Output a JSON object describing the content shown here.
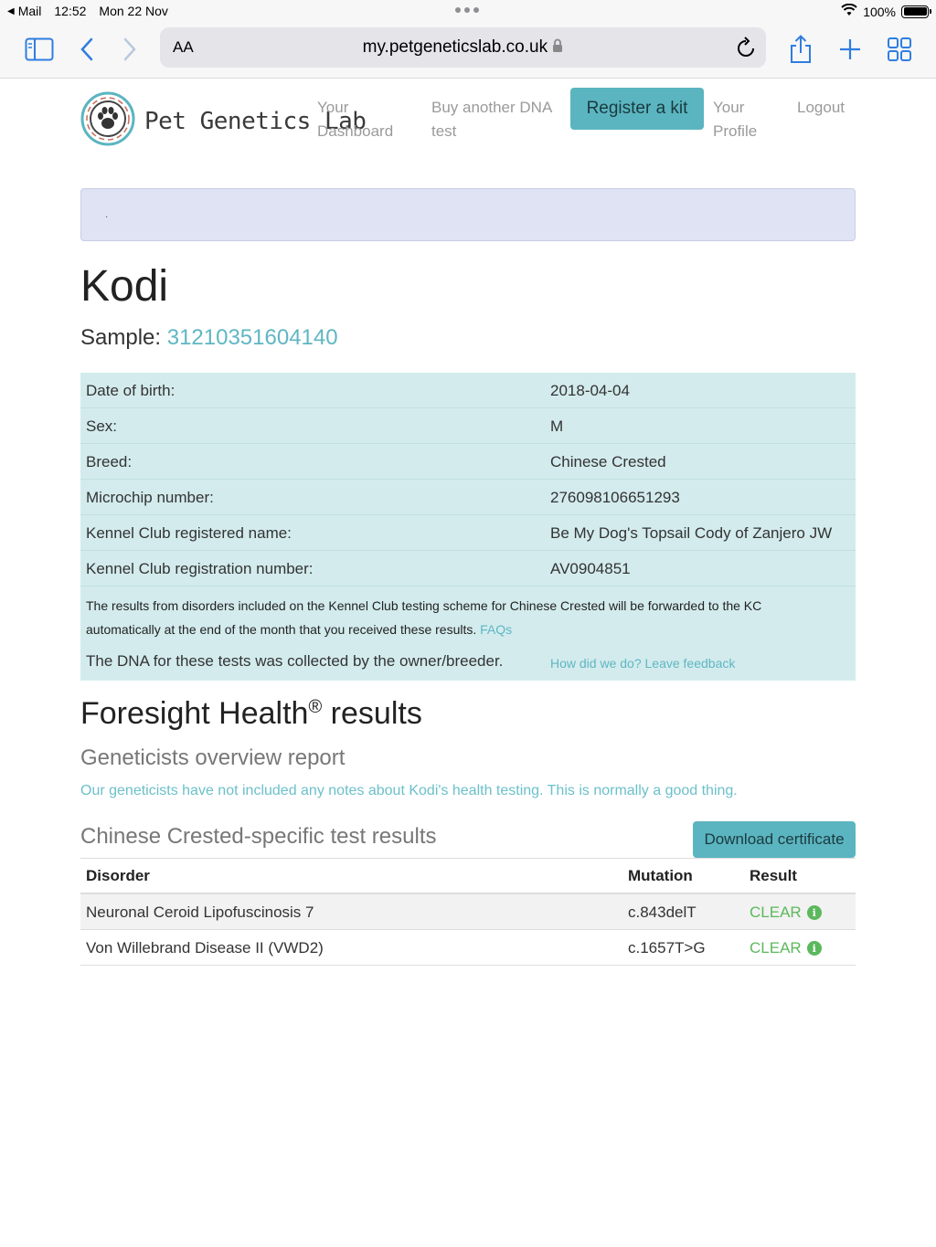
{
  "status_bar": {
    "back_app": "Mail",
    "time": "12:52",
    "date": "Mon 22 Nov",
    "battery": "100%",
    "battery_level": 1.0
  },
  "browser": {
    "aa_label": "AA",
    "url": "my.petgeneticslab.co.uk"
  },
  "site": {
    "brand": "Pet Genetics Lab",
    "nav": {
      "dashboard_line1": "Your",
      "dashboard_line2": "Dashboard",
      "buy_line1": "Buy another DNA",
      "buy_line2": "test",
      "register": "Register a kit",
      "profile_line1": "Your",
      "profile_line2": "Profile",
      "logout": "Logout"
    },
    "alert_text": "."
  },
  "pet": {
    "name": "Kodi",
    "sample_label": "Sample:",
    "sample_id": "31210351604140",
    "details": [
      {
        "label": "Date of birth:",
        "value": "2018-04-04"
      },
      {
        "label": "Sex:",
        "value": "M"
      },
      {
        "label": "Breed:",
        "value": "Chinese Crested"
      },
      {
        "label": "Microchip number:",
        "value": "276098106651293"
      },
      {
        "label": "Kennel Club registered name:",
        "value": "Be My Dog's Topsail Cody of Zanjero JW"
      },
      {
        "label": "Kennel Club registration number:",
        "value": "AV0904851"
      }
    ],
    "kc_note": "The results from disorders included on the Kennel Club testing scheme for Chinese Crested will be forwarded to the KC automatically at the end of the month that you received these results.",
    "kc_faq_link": "FAQs",
    "dna_note": "The DNA for these tests was collected by the owner/breeder.",
    "feedback_link": "How did we do? Leave feedback"
  },
  "results": {
    "heading": "Foresight Health",
    "heading_mark": "®",
    "heading_suffix": "results",
    "overview_heading": "Geneticists overview report",
    "overview_text": "Our geneticists have not included any notes about Kodi's health testing. This is normally a good thing.",
    "specific_heading": "Chinese Crested-specific test results",
    "download_label": "Download certificate",
    "columns": {
      "disorder": "Disorder",
      "mutation": "Mutation",
      "result": "Result"
    },
    "rows": [
      {
        "disorder": "Neuronal Ceroid Lipofuscinosis 7",
        "mutation": "c.843delT",
        "result": "CLEAR"
      },
      {
        "disorder": "Von Willebrand Disease II (VWD2)",
        "mutation": "c.1657T>G",
        "result": "CLEAR"
      }
    ]
  },
  "colors": {
    "accent": "#5bb5c0",
    "info_table_bg": "#d3ebed",
    "clear_green": "#5cb85c",
    "link": "#5fb7c3"
  },
  "icons": [
    "back-arrow-icon",
    "wifi-icon",
    "battery-icon",
    "sidebar-icon",
    "chevron-left-icon",
    "chevron-right-icon",
    "lock-icon",
    "reload-icon",
    "share-icon",
    "plus-icon",
    "tabs-grid-icon",
    "paw-logo-icon",
    "info-icon"
  ]
}
